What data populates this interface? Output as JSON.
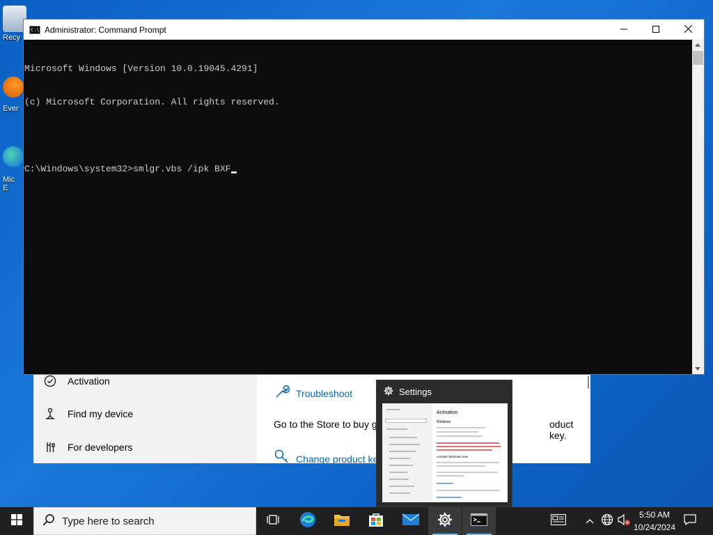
{
  "desktop": {
    "icons": [
      {
        "label": "Recy"
      },
      {
        "label": "Ever"
      },
      {
        "label": "Mic"
      },
      {
        "label": "E"
      }
    ]
  },
  "settings": {
    "nav": {
      "activation": "Activation",
      "find_my_device": "Find my device",
      "for_developers": "For developers"
    },
    "right": {
      "troubleshoot": "Troubleshoot",
      "store_text_a": "Go to the Store to buy ge",
      "store_text_b": "oduct key.",
      "change_key": "Change product ke"
    }
  },
  "cmd": {
    "title": "Administrator: Command Prompt",
    "icon_text": "C:\\.",
    "lines": [
      "Microsoft Windows [Version 10.0.19045.4291]",
      "(c) Microsoft Corporation. All rights reserved.",
      "",
      "C:\\Windows\\system32>smlgr.vbs /ipk BXF"
    ]
  },
  "thumbnail": {
    "title": "Settings",
    "preview_heading": "Activation",
    "preview_sub": "Windows",
    "preview_section": "Activate Windows now"
  },
  "taskbar": {
    "search_placeholder": "Type here to search",
    "time": "5:50 AM",
    "date": "10/24/2024"
  },
  "colors": {
    "accent": "#0067b8",
    "taskbar": "#202020",
    "cmd_bg": "#0c0c0c",
    "cmd_text": "#cccccc",
    "desktop": "#1a78d8"
  }
}
